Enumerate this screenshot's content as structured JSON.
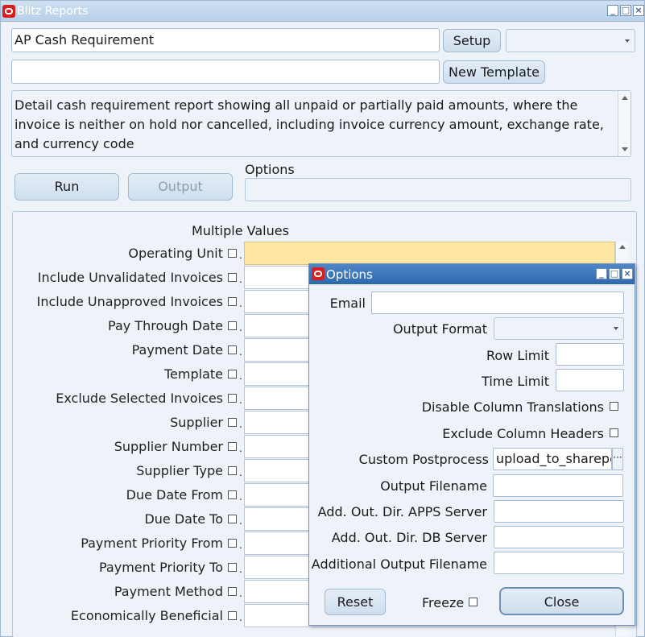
{
  "window": {
    "title": "Blitz Reports"
  },
  "report": {
    "name": "AP Cash Requirement",
    "template_value": "",
    "description": "Detail cash requirement report showing all unpaid or partially paid amounts, where the invoice is neither on hold nor cancelled, including invoice currency amount, exchange rate, and currency code"
  },
  "buttons": {
    "setup": "Setup",
    "new_template": "New Template",
    "run": "Run",
    "output": "Output"
  },
  "options_label": "Options",
  "parameters": {
    "header": "Multiple Values",
    "items": [
      {
        "label": "Operating Unit"
      },
      {
        "label": "Include Unvalidated Invoices"
      },
      {
        "label": "Include Unapproved Invoices"
      },
      {
        "label": "Pay Through Date"
      },
      {
        "label": "Payment Date"
      },
      {
        "label": "Template"
      },
      {
        "label": "Exclude Selected Invoices"
      },
      {
        "label": "Supplier"
      },
      {
        "label": "Supplier Number"
      },
      {
        "label": "Supplier Type"
      },
      {
        "label": "Due Date From"
      },
      {
        "label": "Due Date To"
      },
      {
        "label": "Payment Priority From"
      },
      {
        "label": "Payment Priority To"
      },
      {
        "label": "Payment Method"
      },
      {
        "label": "Economically Beneficial"
      }
    ]
  },
  "dialog": {
    "title": "Options",
    "email_label": "Email",
    "output_format_label": "Output Format",
    "row_limit_label": "Row Limit",
    "time_limit_label": "Time Limit",
    "disable_translations_label": "Disable Column Translations",
    "exclude_headers_label": "Exclude Column Headers",
    "custom_postprocess_label": "Custom Postprocess",
    "custom_postprocess_value": "upload_to_sharepoint",
    "output_filename_label": "Output Filename",
    "apps_dir_label": "Add. Out. Dir. APPS Server",
    "db_dir_label": "Add. Out. Dir. DB Server",
    "additional_filename_label": "Additional Output Filename",
    "reset": "Reset",
    "freeze": "Freeze",
    "close": "Close"
  }
}
